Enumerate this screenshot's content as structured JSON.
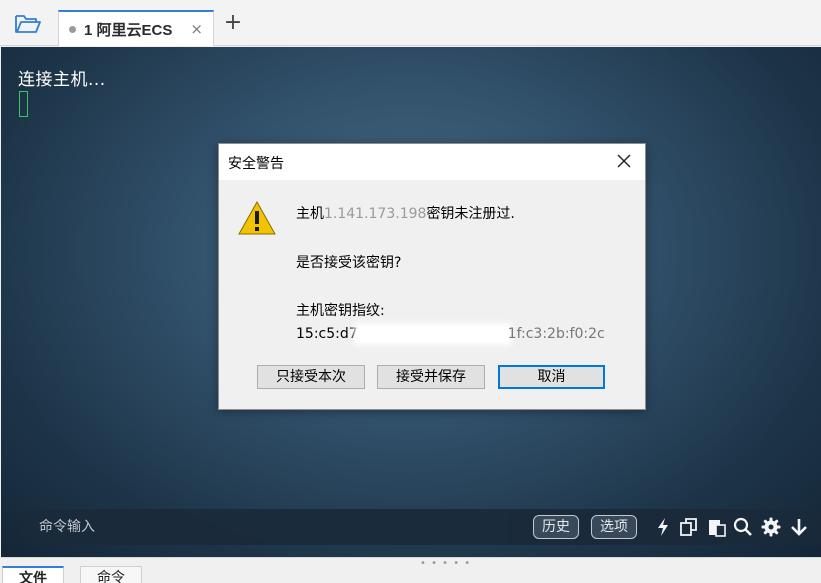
{
  "tabs": {
    "active_label": "1 阿里云ECS",
    "close_glyph": "×",
    "add_glyph": "+"
  },
  "terminal": {
    "status_text": "连接主机..."
  },
  "command_bar": {
    "placeholder": "命令输入",
    "history_label": "历史",
    "options_label": "选项",
    "icons": [
      "lightning-icon",
      "copy-icon",
      "paste-icon",
      "search-icon",
      "gear-icon",
      "arrow-down-icon"
    ]
  },
  "bottom_tabs": {
    "files_label": "文件",
    "commands_label": "命令"
  },
  "dialog": {
    "title": "安全警告",
    "line1_prefix": "主机",
    "line1_visible_ip": "1.141.173.198",
    "line1_suffix": "密钥未注册过.",
    "line2": "是否接受该密钥?",
    "line3": "主机密钥指纹:",
    "fingerprint_start": "15:c5:d7",
    "fingerprint_end": "1f:c3:2b:f0:2c",
    "accept_once_label": "只接受本次",
    "accept_save_label": "接受并保存",
    "cancel_label": "取消"
  },
  "colors": {
    "accent": "#2f7fd6",
    "cursor": "#3cc46a",
    "warning": "#f2c300"
  }
}
